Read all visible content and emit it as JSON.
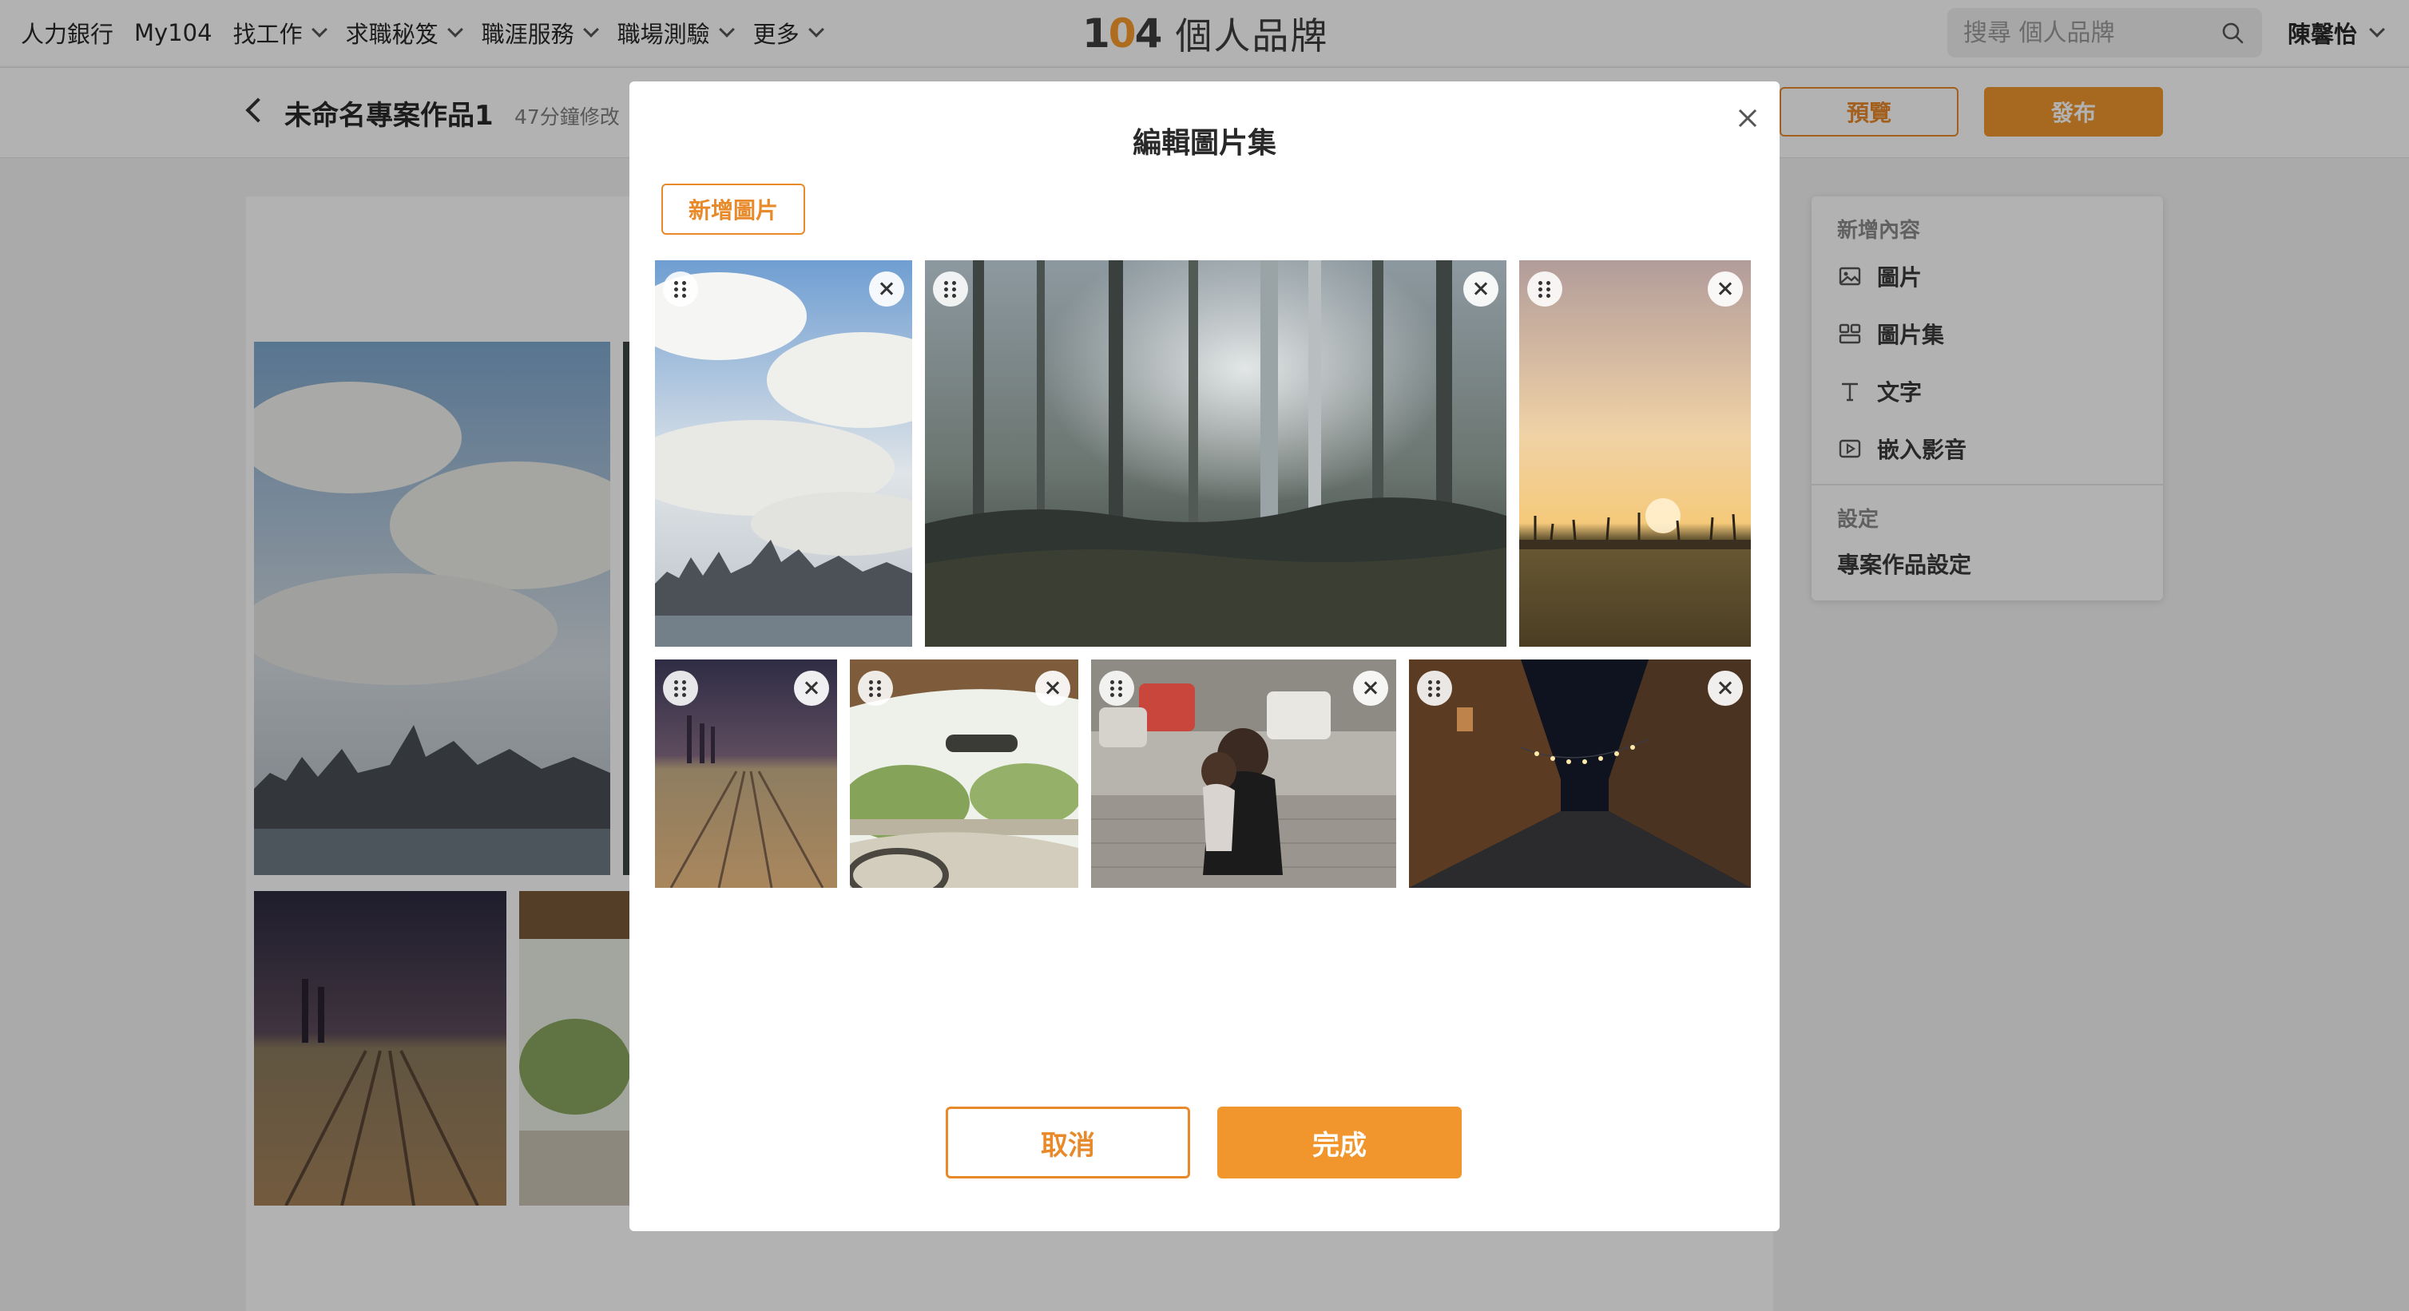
{
  "nav": {
    "items": [
      {
        "label": "人力銀行",
        "has_dropdown": false
      },
      {
        "label": "My104",
        "has_dropdown": false
      },
      {
        "label": "找工作",
        "has_dropdown": true
      },
      {
        "label": "求職秘笈",
        "has_dropdown": true
      },
      {
        "label": "職涯服務",
        "has_dropdown": true
      },
      {
        "label": "職場測驗",
        "has_dropdown": true
      },
      {
        "label": "更多",
        "has_dropdown": true
      }
    ],
    "logo_number": "104",
    "logo_text": "個人品牌",
    "search_placeholder": "搜尋 個人品牌",
    "user_name": "陳馨怡"
  },
  "editor": {
    "project_title": "未命名專案作品1",
    "modified": "47分鐘修改",
    "preview_label": "預覽",
    "publish_label": "發布"
  },
  "side_panel": {
    "add_heading": "新增內容",
    "items": [
      {
        "label": "圖片",
        "icon": "image-icon"
      },
      {
        "label": "圖片集",
        "icon": "gallery-icon"
      },
      {
        "label": "文字",
        "icon": "text-icon"
      },
      {
        "label": "嵌入影音",
        "icon": "video-icon"
      }
    ],
    "settings_heading": "設定",
    "settings_item": "專案作品設定"
  },
  "modal": {
    "title": "編輯圖片集",
    "add_button": "新增圖片",
    "cancel_label": "取消",
    "done_label": "完成",
    "images": [
      {
        "subject": "city skyline under cloudy sky",
        "row": 1
      },
      {
        "subject": "misty pine forest",
        "row": 1
      },
      {
        "subject": "sunset over field",
        "row": 1
      },
      {
        "subject": "railway tracks at dusk",
        "row": 2
      },
      {
        "subject": "view from car interior",
        "row": 2
      },
      {
        "subject": "mother hugging child on street",
        "row": 2
      },
      {
        "subject": "night street with string lights",
        "row": 2
      }
    ]
  },
  "colors": {
    "accent": "#f0962d",
    "accent_border": "#e8892a",
    "overlay": "rgba(0,0,0,0.30)"
  }
}
